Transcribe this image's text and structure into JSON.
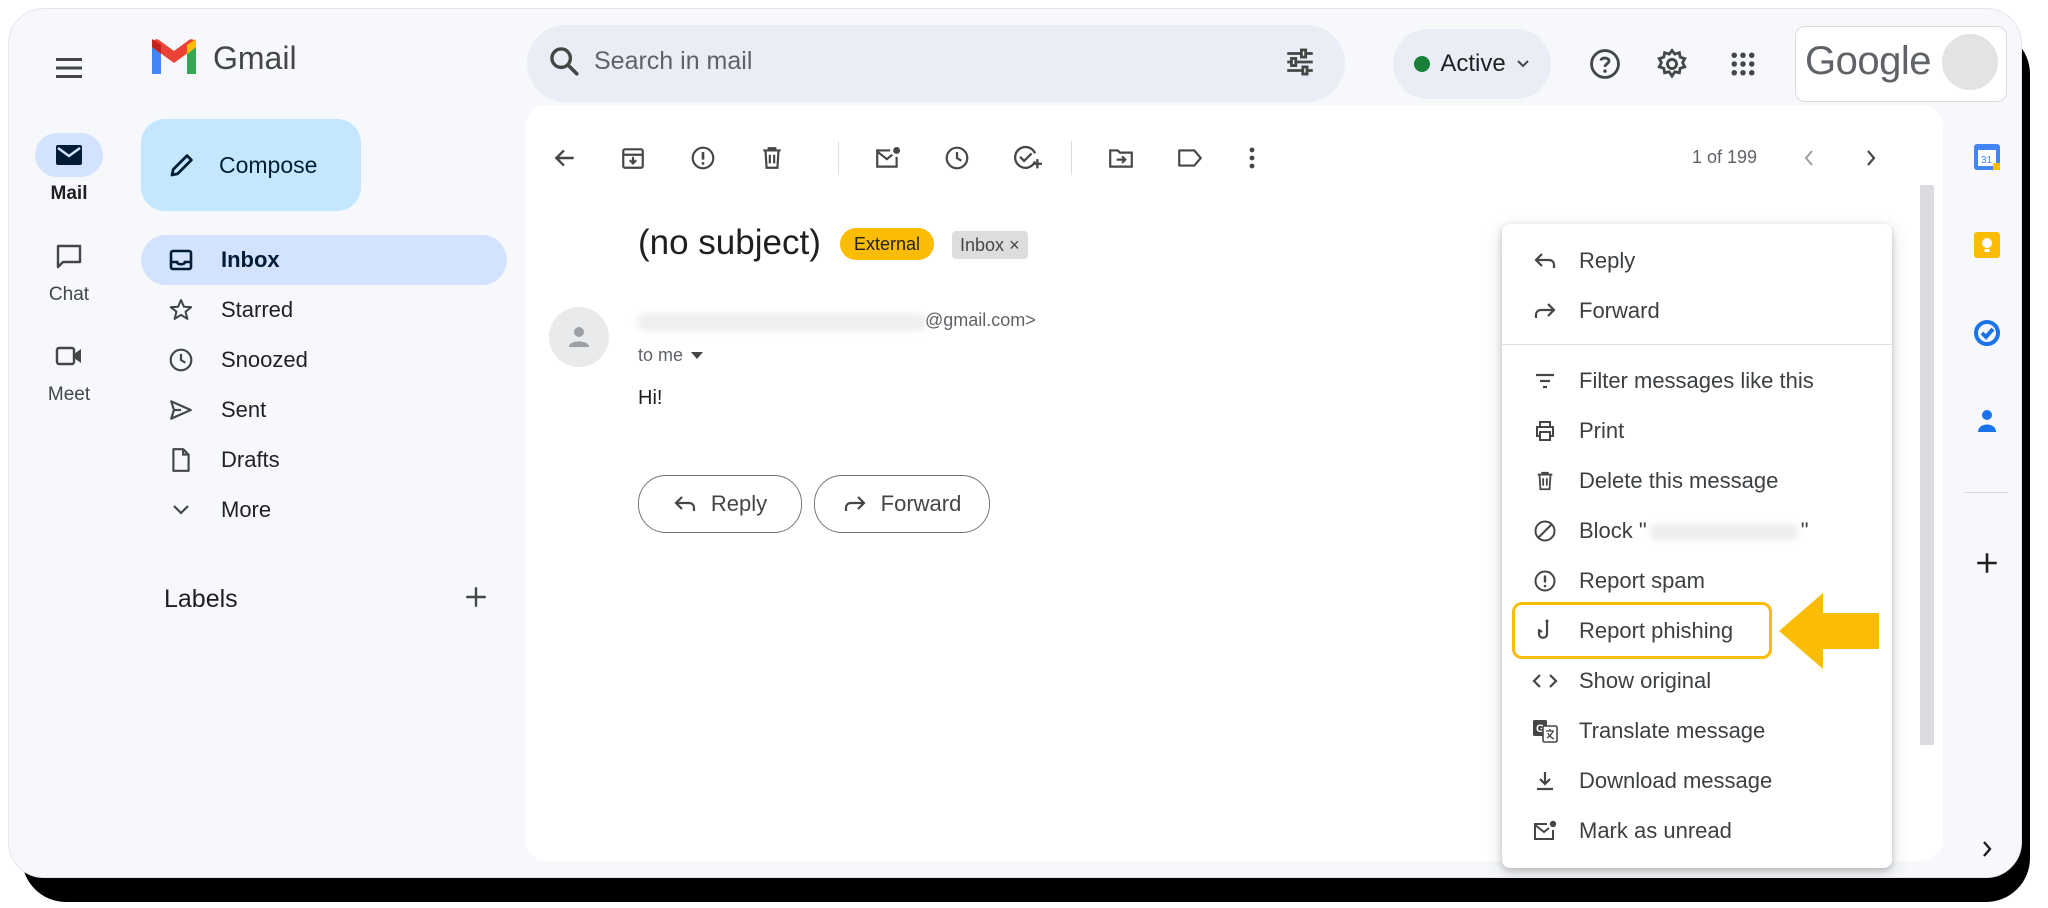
{
  "app": {
    "name": "Gmail",
    "brand_color": "#ea4335"
  },
  "search": {
    "placeholder": "Search in mail"
  },
  "status": {
    "label": "Active",
    "color": "#188038"
  },
  "account": {
    "brand": "Google"
  },
  "rail": [
    {
      "label": "Mail",
      "icon": "mail-icon"
    },
    {
      "label": "Chat",
      "icon": "chat-icon"
    },
    {
      "label": "Meet",
      "icon": "video-icon"
    }
  ],
  "sidebar": {
    "compose_label": "Compose",
    "items": [
      {
        "label": "Inbox",
        "icon": "inbox-icon",
        "selected": true
      },
      {
        "label": "Starred",
        "icon": "star-icon"
      },
      {
        "label": "Snoozed",
        "icon": "clock-icon"
      },
      {
        "label": "Sent",
        "icon": "send-icon"
      },
      {
        "label": "Drafts",
        "icon": "draft-icon"
      },
      {
        "label": "More",
        "icon": "chevron-down-icon"
      }
    ],
    "labels_title": "Labels"
  },
  "toolbar": {
    "pager": "1 of 199",
    "icons": [
      "back-arrow-icon",
      "archive-icon",
      "report-spam-icon",
      "delete-icon",
      "mark-unread-icon",
      "snooze-icon",
      "add-task-icon",
      "move-to-icon",
      "label-icon",
      "more-vert-icon",
      "newer-icon",
      "older-icon"
    ]
  },
  "message": {
    "subject": "(no subject)",
    "chip_external": "External",
    "chip_inbox": "Inbox",
    "chip_inbox_close": "×",
    "sender_domain": "@gmail.com>",
    "to": "to me",
    "body": "Hi!",
    "reply_label": "Reply",
    "forward_label": "Forward"
  },
  "context_menu": {
    "items": [
      {
        "label": "Reply",
        "icon": "reply-icon"
      },
      {
        "label": "Forward",
        "icon": "forward-icon"
      },
      {
        "label": "Filter messages like this",
        "icon": "filter-icon"
      },
      {
        "label": "Print",
        "icon": "print-icon"
      },
      {
        "label": "Delete this message",
        "icon": "delete-icon"
      },
      {
        "label_prefix": "Block \"",
        "label_suffix": "\"",
        "icon": "block-icon"
      },
      {
        "label": "Report spam",
        "icon": "report-spam-icon"
      },
      {
        "label": "Report phishing",
        "icon": "phishing-hook-icon",
        "highlighted": true
      },
      {
        "label": "Show original",
        "icon": "code-icon"
      },
      {
        "label": "Translate message",
        "icon": "translate-icon"
      },
      {
        "label": "Download message",
        "icon": "download-icon"
      },
      {
        "label": "Mark as unread",
        "icon": "mark-unread-icon"
      }
    ],
    "highlight_color": "#fbbc04"
  },
  "right_side": {
    "icons": [
      "calendar-icon",
      "keep-icon",
      "tasks-icon",
      "contacts-icon",
      "add-icon",
      "expand-chevron-icon"
    ],
    "calendar_day": "31"
  }
}
